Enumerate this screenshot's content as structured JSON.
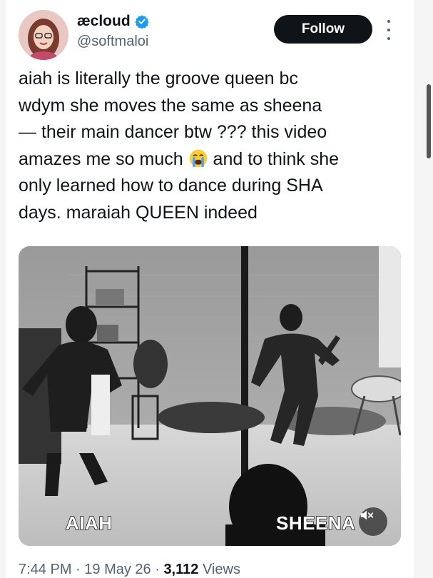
{
  "author": {
    "display_name": "æcloud",
    "handle": "@softmaloi",
    "verified": true
  },
  "follow_label": "Follow",
  "tweet": {
    "text_part1": "aiah is literally the groove queen bc\nwdym she moves the same as sheena\n— their main dancer btw ??? this video\namazes me so much ",
    "emoji": "loudly-crying-face",
    "text_part2": " and to think she\nonly learned how to dance during SHA\ndays. maraiah QUEEN indeed"
  },
  "media": {
    "type": "video",
    "caption_left": "AIAH",
    "caption_right": "SHEENA",
    "muted": true
  },
  "meta": {
    "time": "7:44 PM",
    "separator": " · ",
    "date": "19 May 26",
    "views_count": "3,112",
    "views_label": "Views"
  },
  "colors": {
    "text": "#0f1419",
    "secondary": "#536471",
    "verified": "#1d9bf0",
    "follow_bg": "#0f1419"
  }
}
